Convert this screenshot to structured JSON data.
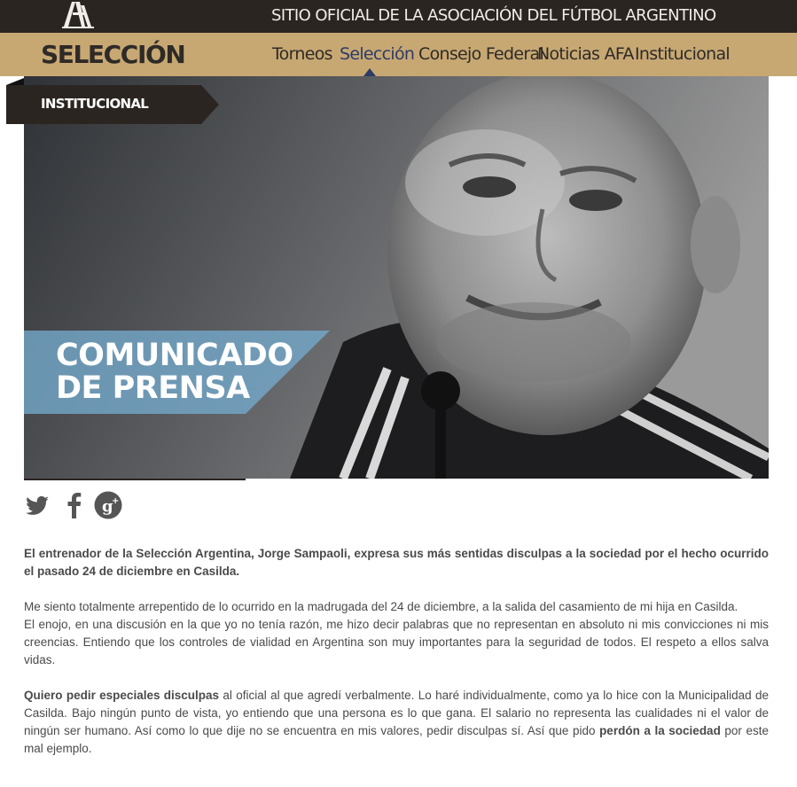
{
  "header": {
    "logo_text": "AFA",
    "site_title": "SITIO OFICIAL DE LA ASOCIACIÓN DEL FÚTBOL ARGENTINO"
  },
  "navbar": {
    "brand": "SELECCIÓN",
    "items": [
      {
        "label": "Torneos",
        "active": false
      },
      {
        "label": "Selección",
        "active": true
      },
      {
        "label": "Consejo Federal",
        "active": false
      },
      {
        "label": "Noticias AFA",
        "active": false
      },
      {
        "label": "Institucional",
        "active": false
      }
    ]
  },
  "hero": {
    "section_label": "INSTITUCIONAL",
    "headline_line1": "COMUNICADO",
    "headline_line2": "DE PRENSA"
  },
  "social": {
    "icons": [
      "twitter-icon",
      "facebook-icon",
      "google-plus-icon"
    ]
  },
  "article": {
    "lead": "El entrenador de la Selección Argentina, Jorge Sampaoli, expresa sus más sentidas disculpas a la sociedad por el hecho ocurrido el pasado 24 de diciembre en Casilda.",
    "p1_line1": "Me siento totalmente arrepentido de lo ocurrido en la madrugada del 24 de diciembre, a la salida del casamiento de mi hija en Casilda.",
    "p1_line2": "El enojo, en una discusión en la que yo no tenía razón, me hizo decir palabras que no representan en absoluto ni mis convicciones ni mis creencias. Entiendo que los controles de vialidad en Argentina son muy importantes para la seguridad de todos. El respeto a ellos salva vidas.",
    "p2_bold1": "Quiero pedir especiales disculpas",
    "p2_text1": " al oficial al que agredí verbalmente. Lo haré individualmente, como ya lo hice con la Municipalidad de Casilda. Bajo ningún punto de vista, yo entiendo que una persona es lo que gana. El salario no representa las cualidades ni el valor de ningún ser humano. Así como lo que dije no se encuentra en mis valores, pedir disculpas sí. Así que pido ",
    "p2_bold2": "perdón a la sociedad",
    "p2_text2": " por este mal ejemplo."
  },
  "colors": {
    "topbar": "#2b2522",
    "navbar": "#c7a873",
    "active_nav": "#2d3b66",
    "headline_band": "#75aacd"
  }
}
